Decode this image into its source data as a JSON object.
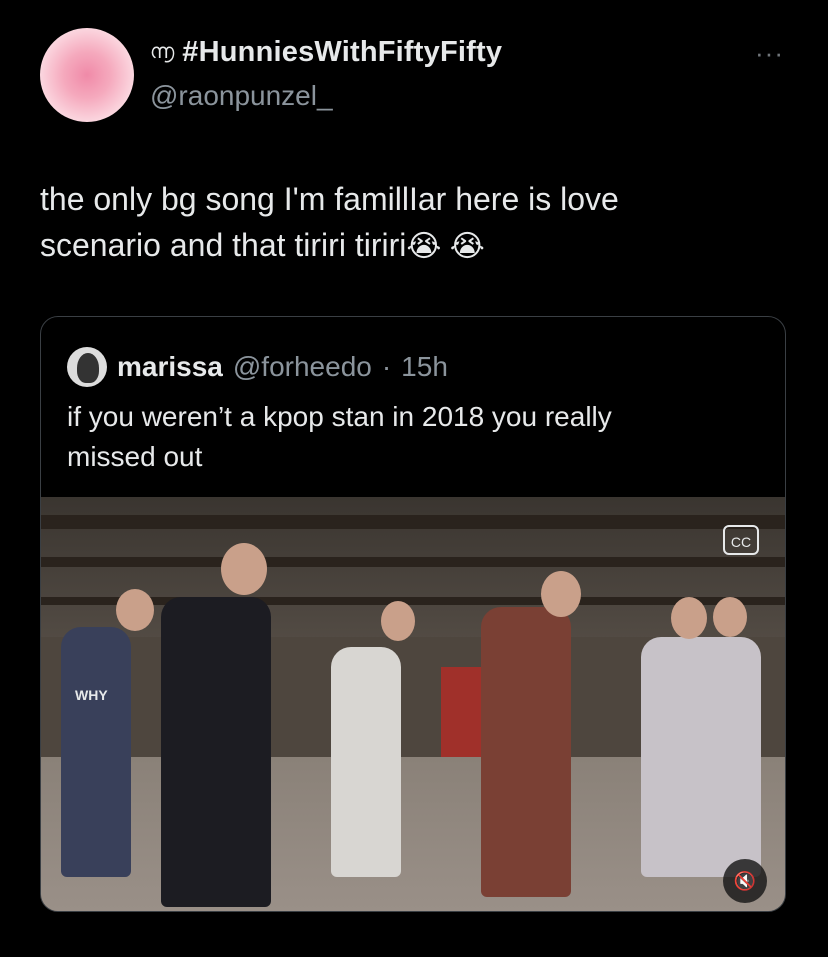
{
  "tweet": {
    "display_name_icon": "spiral-icon",
    "display_name": "#HunniesWithFiftyFifty",
    "handle": "@raonpunzel_",
    "more_label": "···",
    "text_line1": "the only bg song I'm famillIar here is love",
    "text_line2": "scenario and that tiriri tiriri",
    "emoji": "😭 😭"
  },
  "quote": {
    "name": "marissa",
    "handle": "@forheedo",
    "separator": "·",
    "time": "15h",
    "text_line1": "if you weren’t a kpop stan in 2018 you really",
    "text_line2": "missed out"
  },
  "media": {
    "cc_label": "CC",
    "mute_icon": "🔇",
    "shirt_text": "WHY"
  }
}
